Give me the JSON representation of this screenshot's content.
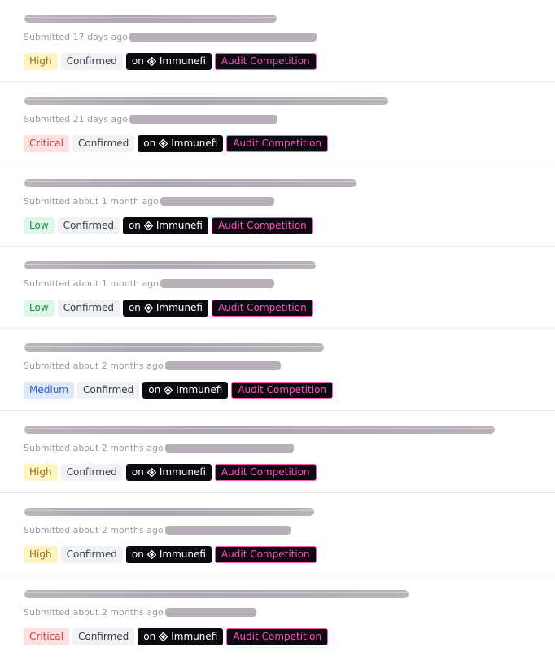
{
  "colors": {
    "high_bg": "#fdf6c3",
    "critical_bg": "#fde0e0",
    "low_bg": "#dff7e6",
    "medium_bg": "#dde8fb",
    "competition_accent": "#ff4fbf"
  },
  "platform_icon": "immunefi-logo-icon",
  "reports": [
    {
      "submitted": "Submitted 17 days ago",
      "severity": "High",
      "severity_class": "sev-high",
      "status": "Confirmed",
      "platform_prefix": "on",
      "platform": "Immunefi",
      "tag": "Audit Competition"
    },
    {
      "submitted": "Submitted 21 days ago",
      "severity": "Critical",
      "severity_class": "sev-critical",
      "status": "Confirmed",
      "platform_prefix": "on",
      "platform": "Immunefi",
      "tag": "Audit Competition"
    },
    {
      "submitted": "Submitted about 1 month ago",
      "severity": "Low",
      "severity_class": "sev-low",
      "status": "Confirmed",
      "platform_prefix": "on",
      "platform": "Immunefi",
      "tag": "Audit Competition"
    },
    {
      "submitted": "Submitted about 1 month ago",
      "severity": "Low",
      "severity_class": "sev-low",
      "status": "Confirmed",
      "platform_prefix": "on",
      "platform": "Immunefi",
      "tag": "Audit Competition"
    },
    {
      "submitted": "Submitted about 2 months ago",
      "severity": "Medium",
      "severity_class": "sev-medium",
      "status": "Confirmed",
      "platform_prefix": "on",
      "platform": "Immunefi",
      "tag": "Audit Competition"
    },
    {
      "submitted": "Submitted about 2 months ago",
      "severity": "High",
      "severity_class": "sev-high",
      "status": "Confirmed",
      "platform_prefix": "on",
      "platform": "Immunefi",
      "tag": "Audit Competition"
    },
    {
      "submitted": "Submitted about 2 months ago",
      "severity": "High",
      "severity_class": "sev-high",
      "status": "Confirmed",
      "platform_prefix": "on",
      "platform": "Immunefi",
      "tag": "Audit Competition"
    },
    {
      "submitted": "Submitted about 2 months ago",
      "severity": "Critical",
      "severity_class": "sev-critical",
      "status": "Confirmed",
      "platform_prefix": "on",
      "platform": "Immunefi",
      "tag": "Audit Competition"
    }
  ]
}
